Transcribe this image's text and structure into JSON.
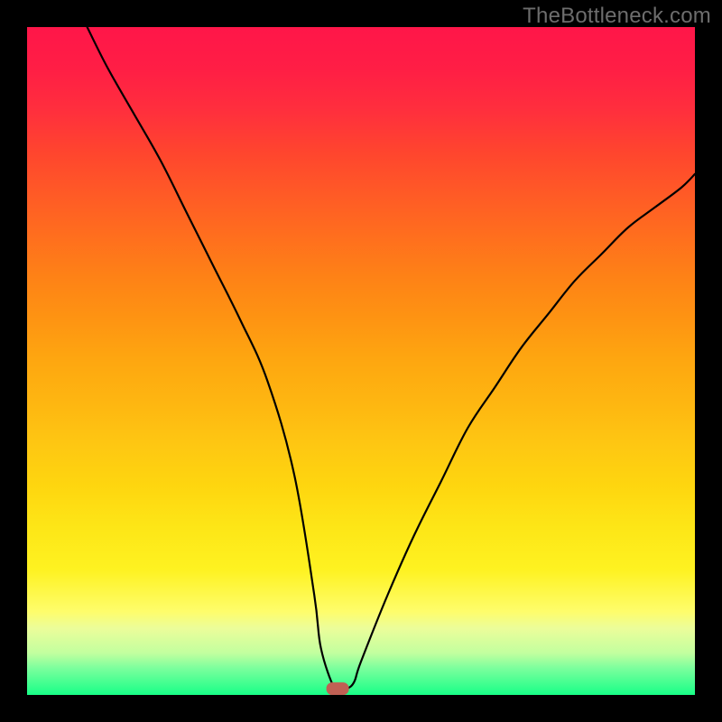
{
  "watermark": "TheBottleneck.com",
  "chart_data": {
    "type": "line",
    "title": "",
    "xlabel": "",
    "ylabel": "",
    "xlim": [
      0,
      100
    ],
    "ylim": [
      0,
      100
    ],
    "grid": false,
    "legend": false,
    "note": "Axes are unlabeled percent scales inferred from plot extents.",
    "series": [
      {
        "name": "bottleneck-curve",
        "x": [
          9,
          12,
          16,
          20,
          24,
          28,
          32,
          36,
          40,
          43,
          44,
          46,
          47,
          48,
          49,
          50,
          54,
          58,
          62,
          66,
          70,
          74,
          78,
          82,
          86,
          90,
          94,
          98,
          100
        ],
        "y": [
          100,
          94,
          87,
          80,
          72,
          64,
          56,
          47,
          33,
          15,
          7,
          1,
          1,
          1,
          2,
          5,
          15,
          24,
          32,
          40,
          46,
          52,
          57,
          62,
          66,
          70,
          73,
          76,
          78
        ]
      }
    ],
    "minimum_marker": {
      "x": 46.5,
      "y": 1
    },
    "gradient_stops": [
      {
        "pos": 0.0,
        "color": "#ff1649"
      },
      {
        "pos": 0.25,
        "color": "#ff5a26"
      },
      {
        "pos": 0.5,
        "color": "#fea710"
      },
      {
        "pos": 0.75,
        "color": "#fde617"
      },
      {
        "pos": 0.9,
        "color": "#ecfd9a"
      },
      {
        "pos": 1.0,
        "color": "#18ff87"
      }
    ]
  }
}
